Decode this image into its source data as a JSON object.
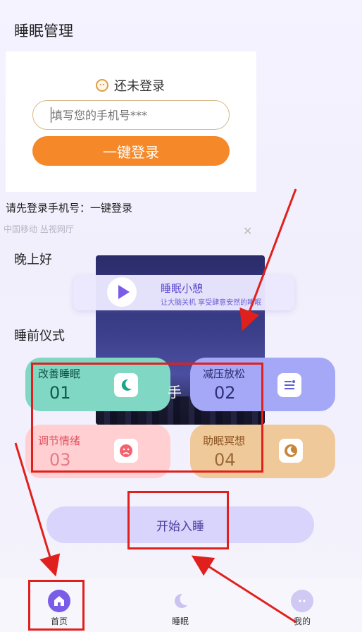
{
  "header": {
    "title": "睡眠管理"
  },
  "login": {
    "status_text": "还未登录",
    "phone_placeholder": "填写您的手机号***",
    "login_button": "一键登录",
    "hint": "请先登录手机号：一键登录",
    "carrier": "中国移动 丛视网厅"
  },
  "greeting": "晚上好",
  "ad": {
    "overlay_text": "手"
  },
  "nap": {
    "title": "睡眠小憩",
    "subtitle": "让大脑关机 享受肆意安然的睡眠"
  },
  "ritual": {
    "title": "睡前仪式",
    "cards": [
      {
        "label": "改善睡眠",
        "number": "01",
        "icon": "moon-leaf-icon"
      },
      {
        "label": "减压放松",
        "number": "02",
        "icon": "list-icon"
      },
      {
        "label": "调节情绪",
        "number": "03",
        "icon": "sad-face-icon"
      },
      {
        "label": "助眠冥想",
        "number": "04",
        "icon": "meditation-icon"
      }
    ]
  },
  "start_button": "开始入睡",
  "tabs": [
    {
      "label": "首页",
      "icon": "home-icon"
    },
    {
      "label": "睡眠",
      "icon": "moon-icon"
    },
    {
      "label": "我的",
      "icon": "profile-icon"
    }
  ],
  "colors": {
    "accent_orange": "#f5892a",
    "accent_purple": "#7a5ce8",
    "annotation_red": "#e0201c"
  }
}
